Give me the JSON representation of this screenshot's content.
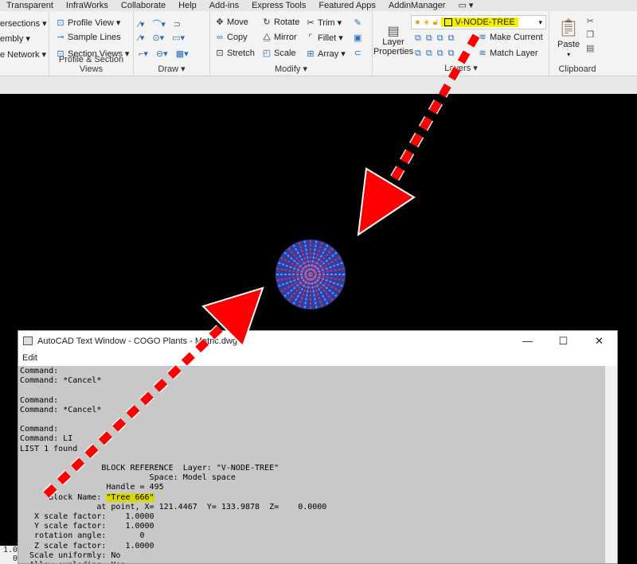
{
  "tabs": [
    "Transparent",
    "InfraWorks",
    "Collaborate",
    "Help",
    "Add-ins",
    "Express Tools",
    "Featured Apps",
    "AddinManager"
  ],
  "ribbon": {
    "create_design": {
      "items": [
        "ersections",
        "embly",
        "e Network"
      ]
    },
    "profile_section": {
      "items": [
        "Profile View",
        "Sample Lines",
        "Section Views"
      ],
      "title": "Profile & Section Views"
    },
    "draw": {
      "title": "Draw"
    },
    "modify": {
      "items": [
        "Move",
        "Rotate",
        "Trim",
        "Copy",
        "Mirror",
        "Fillet",
        "Stretch",
        "Scale",
        "Array"
      ],
      "title": "Modify"
    },
    "layers": {
      "current_layer": "V-NODE-TREE",
      "layer_properties": "Layer Properties",
      "make_current": "Make Current",
      "match_layer": "Match Layer",
      "title": "Layers"
    },
    "clipboard": {
      "paste": "Paste",
      "title": "Clipboard"
    }
  },
  "text_window": {
    "title": "AutoCAD Text Window - COGO Plants - Metric.dwg",
    "menu": [
      "Edit"
    ],
    "lines_before": "Command:\nCommand: *Cancel*\n\nCommand:\nCommand: *Cancel*\n\nCommand:\nCommand: LI\nLIST 1 found\n\n                 BLOCK REFERENCE  Layer: \"V-NODE-TREE\"\n                           Space: Model space\n                  Handle = 495\n      Block Name: ",
    "block_name": "\"Tree 666\"",
    "lines_after": "\n                at point, X= 121.4467  Y= 133.9878  Z=    0.0000\n   X scale factor:    1.0000\n   Y scale factor:    1.0000\n   rotation angle:       0\n   Z scale factor:    1.0000\n  Scale uniformly: No\n  Allow exploding: Yes"
  },
  "background_text": "1.0\n  0",
  "colors": {
    "highlight": "#f5f000",
    "arrow": "#ff0000",
    "tree": "#3a5fd8"
  }
}
